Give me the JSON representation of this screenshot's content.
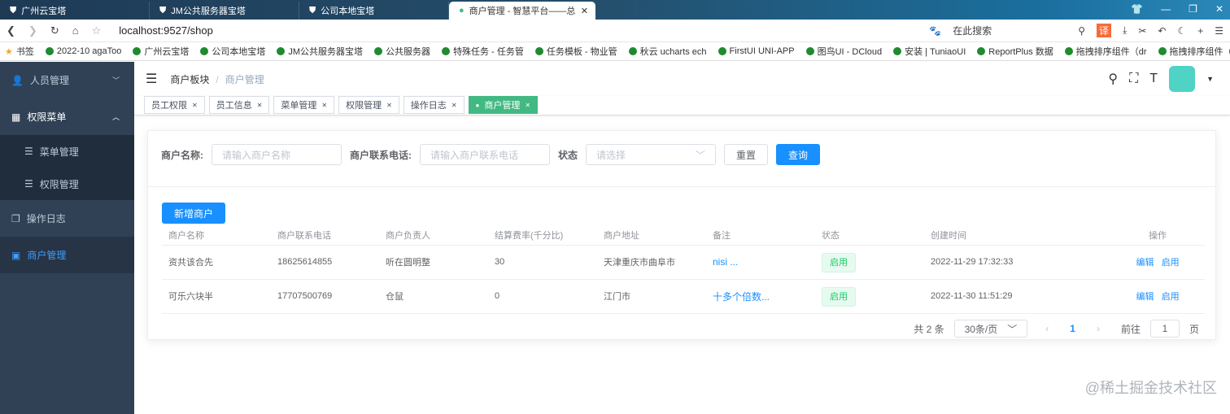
{
  "browser": {
    "tabs": [
      {
        "label": "广州云宝塔"
      },
      {
        "label": "JM公共服务器宝塔"
      },
      {
        "label": "公司本地宝塔"
      },
      {
        "label": "商户管理 - 智慧平台——总后台"
      }
    ],
    "url": "localhost:9527/shop",
    "search_placeholder": "在此搜索",
    "bookmarks": [
      "书签",
      "2022-10 agaToo",
      "广州云宝塔",
      "公司本地宝塔",
      "JM公共服务器宝塔",
      "公共服务器",
      "特殊任务 - 任务管",
      "任务模板 - 物业管",
      "秋云 ucharts ech",
      "FirstUI UNI-APP",
      "图鸟UI - DCloud",
      "安装 | TuniaoUI",
      "ReportPlus 数据",
      "拖拽排序组件（dr",
      "拖拽排序组件（dr"
    ]
  },
  "sidebar": {
    "items": [
      {
        "label": "人员管理"
      },
      {
        "label": "权限菜单"
      },
      {
        "label": "菜单管理"
      },
      {
        "label": "权限管理"
      },
      {
        "label": "操作日志"
      },
      {
        "label": "商户管理"
      }
    ]
  },
  "breadcrumb": {
    "parent": "商户板块",
    "current": "商户管理"
  },
  "tags": [
    {
      "label": "员工权限"
    },
    {
      "label": "员工信息"
    },
    {
      "label": "菜单管理"
    },
    {
      "label": "权限管理"
    },
    {
      "label": "操作日志"
    },
    {
      "label": "商户管理"
    }
  ],
  "form": {
    "name_label": "商户名称:",
    "name_placeholder": "请输入商户名称",
    "phone_label": "商户联系电话:",
    "phone_placeholder": "请输入商户联系电话",
    "status_label": "状态",
    "status_placeholder": "请选择",
    "reset": "重置",
    "search": "查询"
  },
  "add_button": "新增商户",
  "table": {
    "headers": [
      "商户名称",
      "商户联系电话",
      "商户负责人",
      "结算费率(千分比)",
      "商户地址",
      "备注",
      "状态",
      "创建时间",
      "操作"
    ],
    "rows": [
      {
        "name": "资共该合先",
        "phone": "18625614855",
        "owner": "听在圆明整",
        "rate": "30",
        "address": "天津重庆市曲阜市",
        "remark": "nisi ...",
        "status": "启用",
        "created": "2022-11-29 17:32:33",
        "edit": "编辑",
        "toggle": "启用"
      },
      {
        "name": "可乐六块半",
        "phone": "17707500769",
        "owner": "仓鼠",
        "rate": "0",
        "address": "江门市",
        "remark": "十多个倍数...",
        "status": "启用",
        "created": "2022-11-30 11:51:29",
        "edit": "编辑",
        "toggle": "启用"
      }
    ]
  },
  "pagination": {
    "total": "共 2 条",
    "page_size": "30条/页",
    "current": "1",
    "goto_label": "前往",
    "goto_value": "1",
    "page_unit": "页"
  },
  "watermark": "@稀土掘金技术社区"
}
